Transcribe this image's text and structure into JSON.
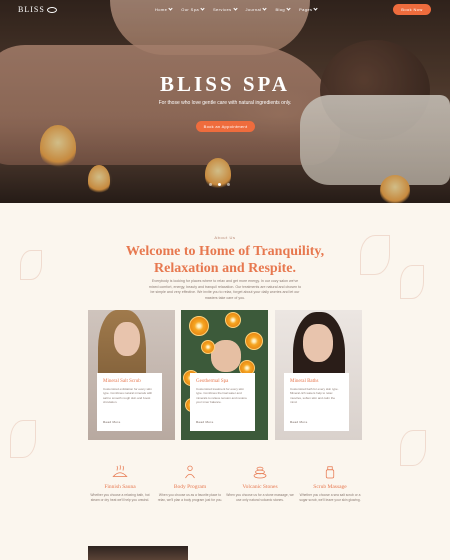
{
  "brand": {
    "logo_text": "BLISS",
    "accent": "#ef6c3d"
  },
  "nav": {
    "items": [
      "Home",
      "Our Spa",
      "Services",
      "Journal",
      "Blog",
      "Pages"
    ],
    "book_label": "Book Now"
  },
  "hero": {
    "title": "BLISS SPA",
    "subtitle": "For those who love gentle care with natural ingredients only.",
    "cta": "Book an Appointment",
    "slide_count": 3,
    "active_slide": 2
  },
  "welcome": {
    "eyebrow": "About Us",
    "title_line1": "Welcome to Home of Tranquility,",
    "title_line2": "Relaxation and Respite.",
    "intro": "Everybody is looking for places where to relax and get more energy. In our cozy salon we've mixed comfort, energy, beauty and tranquil relaxation. Our treatments are natural and chosen to be simple and very effective. We invite you to relax, forget about your daily worries and let our masters take care of you."
  },
  "cards": [
    {
      "title": "Mineral Salt Scrub",
      "text": "Customized exfoliation for every skin type. Combines natural minerals with salt to smooth rough skin and boost circulation.",
      "more": "Read More"
    },
    {
      "title": "Geothermal Spa",
      "text": "Customized treatment for every skin type. Combines thermal water and minerals to relieve tension and restore your inner balance.",
      "more": "Read More"
    },
    {
      "title": "Mineral Baths",
      "text": "Customized bath for every skin type. Mineral-rich waters help to relax muscles, soften skin and calm the mind.",
      "more": "Read More"
    }
  ],
  "features": [
    {
      "title": "Finnish Sauna",
      "text": "Whether you choose a relaxing bath, hot steam or dry heat we'll help you unwind.",
      "icon": "sauna-icon"
    },
    {
      "title": "Body Program",
      "text": "When you choose us as a favorite place to relax, we'll plan a body program just for you.",
      "icon": "body-icon"
    },
    {
      "title": "Volcanic Stones",
      "text": "When you choose us for a stone massage, we use only natural volcanic stones.",
      "icon": "stones-icon"
    },
    {
      "title": "Scrub Massage",
      "text": "Whether you choose a sea salt scrub or a sugar scrub, we'll leave your skin glowing.",
      "icon": "scrub-icon"
    }
  ]
}
